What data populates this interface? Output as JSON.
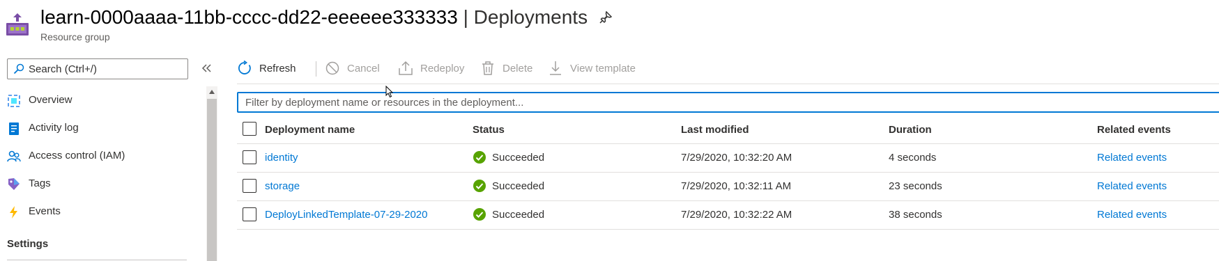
{
  "header": {
    "resource_name": "learn-0000aaaa-11bb-cccc-dd22-eeeeee333333",
    "separator": "|",
    "page": "Deployments",
    "resource_type": "Resource group"
  },
  "sidebar": {
    "search_placeholder": "Search (Ctrl+/)",
    "items": [
      {
        "label": "Overview",
        "icon": "overview-icon"
      },
      {
        "label": "Activity log",
        "icon": "activity-log-icon"
      },
      {
        "label": "Access control (IAM)",
        "icon": "access-control-icon"
      },
      {
        "label": "Tags",
        "icon": "tag-icon"
      },
      {
        "label": "Events",
        "icon": "lightning-icon"
      }
    ],
    "section_label": "Settings"
  },
  "toolbar": {
    "refresh": "Refresh",
    "cancel": "Cancel",
    "redeploy": "Redeploy",
    "delete": "Delete",
    "view_template": "View template"
  },
  "filter": {
    "placeholder": "Filter by deployment name or resources in the deployment..."
  },
  "table": {
    "columns": [
      "Deployment name",
      "Status",
      "Last modified",
      "Duration",
      "Related events"
    ],
    "rows": [
      {
        "name": "identity",
        "status": "Succeeded",
        "modified": "7/29/2020, 10:32:20 AM",
        "duration": "4 seconds",
        "related": "Related events"
      },
      {
        "name": "storage",
        "status": "Succeeded",
        "modified": "7/29/2020, 10:32:11 AM",
        "duration": "23 seconds",
        "related": "Related events"
      },
      {
        "name": "DeployLinkedTemplate-07-29-2020",
        "status": "Succeeded",
        "modified": "7/29/2020, 10:32:22 AM",
        "duration": "38 seconds",
        "related": "Related events"
      }
    ]
  },
  "colors": {
    "accent": "#0078d4",
    "success": "#57a300",
    "resource_group": "#7a4ea6"
  }
}
